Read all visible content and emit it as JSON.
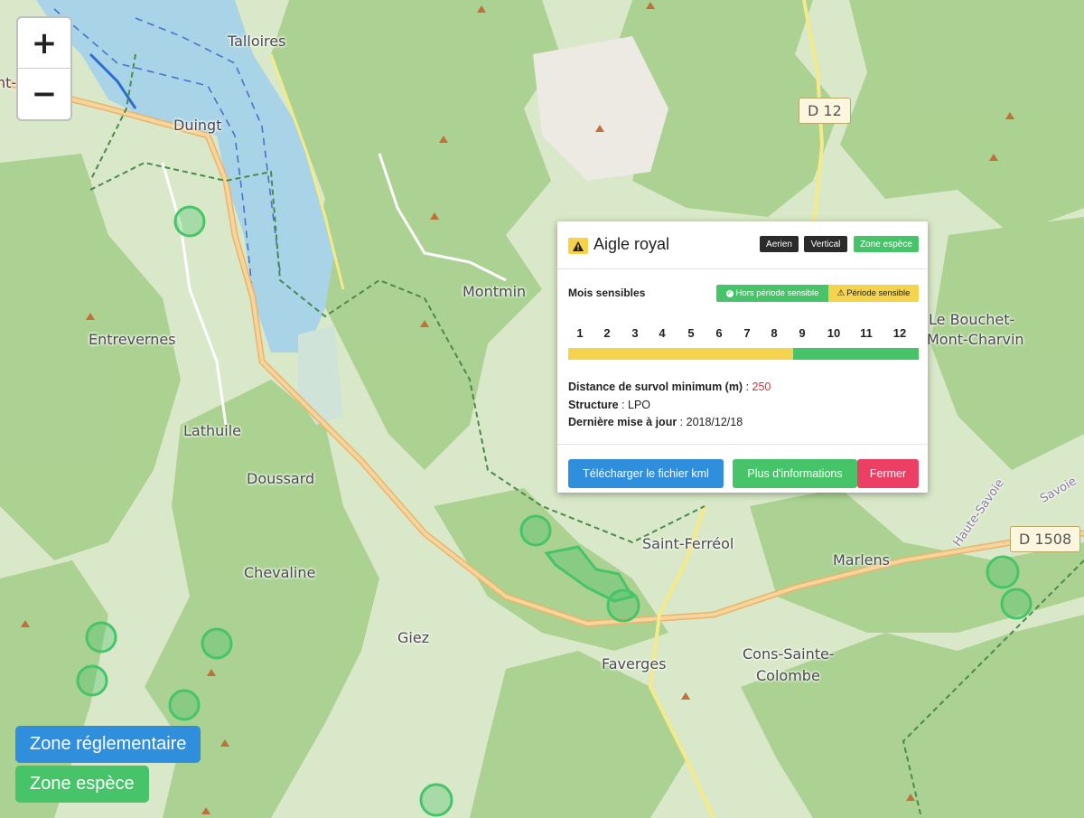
{
  "map": {
    "zoom_in_label": "+",
    "zoom_out_label": "−",
    "places": [
      {
        "id": "talloires",
        "label": "Talloires"
      },
      {
        "id": "duingt",
        "label": "Duingt"
      },
      {
        "id": "entrevernes",
        "label": "Entrevernes"
      },
      {
        "id": "montmin",
        "label": "Montmin"
      },
      {
        "id": "lathuile",
        "label": "Lathuile"
      },
      {
        "id": "doussard",
        "label": "Doussard"
      },
      {
        "id": "chevaline",
        "label": "Chevaline"
      },
      {
        "id": "giez",
        "label": "Giez"
      },
      {
        "id": "faverges",
        "label": "Faverges"
      },
      {
        "id": "saint-ferreol",
        "label": "Saint-Ferréol"
      },
      {
        "id": "marlens",
        "label": "Marlens"
      },
      {
        "id": "le-bouchet",
        "label": "Le Bouchet-"
      },
      {
        "id": "mont-charvin",
        "label": "Mont-Charvin"
      },
      {
        "id": "cons-sainte",
        "label": "Cons-Sainte-"
      },
      {
        "id": "colombe",
        "label": "Colombe"
      },
      {
        "id": "partial-left-top",
        "label": "nt-J"
      },
      {
        "id": "haute-savoie",
        "label": "Haute-Savoie"
      },
      {
        "id": "savoie",
        "label": "Savoie"
      }
    ],
    "road_shields": [
      {
        "id": "d12",
        "label": "D 12"
      },
      {
        "id": "d1508",
        "label": "D 1508"
      }
    ]
  },
  "legend": {
    "zone_reglementaire": "Zone réglementaire",
    "zone_espece": "Zone espèce"
  },
  "popup": {
    "title": "Aigle royal",
    "tags": [
      "Aerien",
      "Vertical",
      "Zone espèce"
    ],
    "section_label": "Mois sensibles",
    "legend_hors": "Hors période sensible",
    "legend_periode": "Période sensible",
    "months": [
      "1",
      "2",
      "3",
      "4",
      "5",
      "6",
      "7",
      "8",
      "9",
      "10",
      "11",
      "12"
    ],
    "sensitive_months": [
      1,
      2,
      3,
      4,
      5,
      6,
      7,
      8
    ],
    "distance_label": "Distance de survol minimum (m)",
    "distance_value": "250",
    "structure_label": "Structure",
    "structure_value": "LPO",
    "update_label": "Dernière mise à jour",
    "update_value": "2018/12/18",
    "btn_download": "Télécharger le fichier kml",
    "btn_more": "Plus d'informations",
    "btn_close": "Fermer"
  },
  "colors": {
    "sensitive": "#f5d34c",
    "non_sensitive": "#47c46a",
    "blue_button": "#2f8fdc",
    "green_button": "#47c46a",
    "red_button": "#ed3e64",
    "dark_tag": "#2b2b2b",
    "distance_value": "#e03030",
    "lake": "#a9d3e6",
    "forest": "#a9d18f"
  }
}
